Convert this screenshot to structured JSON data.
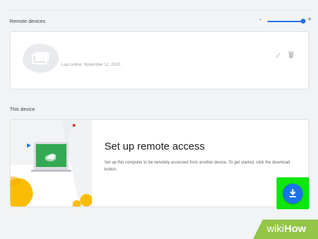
{
  "zoom": {
    "minus": "-",
    "plus": "+",
    "level": 1.0
  },
  "remote_devices": {
    "label": "Remote devices",
    "device": {
      "last_online": "Last online: November 12, 2020"
    }
  },
  "this_device": {
    "label": "This device",
    "setup": {
      "title": "Set up remote access",
      "description": "Set up this computer to be remotely accessed from another device. To get started, click the download button."
    }
  },
  "watermark": {
    "wiki": "wiki",
    "how": "How"
  },
  "colors": {
    "accent": "#1a73e8",
    "highlight": "#11e50b",
    "background": "#f1f3f4"
  },
  "icons": [
    "device-icon",
    "edit-icon",
    "delete-icon",
    "download-icon"
  ]
}
